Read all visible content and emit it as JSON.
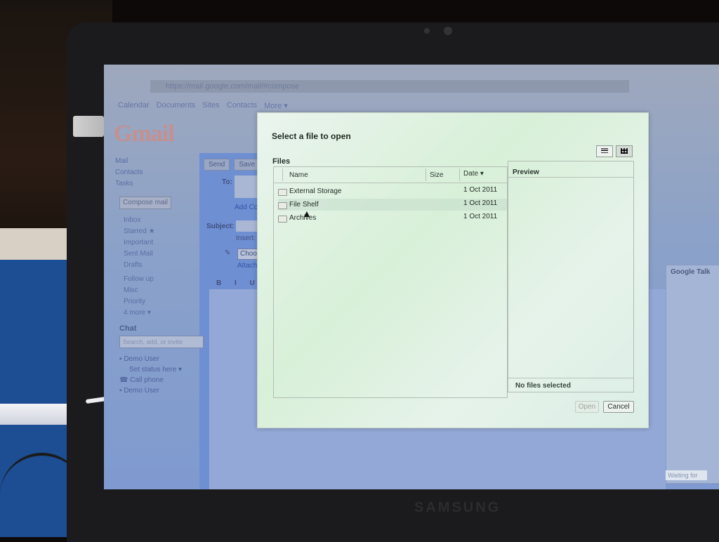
{
  "browser": {
    "url": "https://mail.google.com/mail/#compose"
  },
  "gmail": {
    "logo": "Gmail",
    "topnav": [
      "Calendar",
      "Documents",
      "Sites",
      "Contacts",
      "More ▾"
    ],
    "left_nav": [
      "Mail",
      "Contacts",
      "Tasks"
    ],
    "compose_button": "Compose mail",
    "labels": [
      "Inbox",
      "Starred ★",
      "Important",
      "Sent Mail",
      "Drafts",
      "Follow up",
      "Misc",
      "Priority",
      "4 more ▾"
    ],
    "chat": {
      "title": "Chat",
      "search_placeholder": "Search, add, or invite",
      "items": [
        "Demo User",
        "Set status here ▾",
        "Call phone",
        "Demo User"
      ]
    },
    "compose": {
      "send_label": "Send",
      "save_label": "Save",
      "to_label": "To:",
      "add_cc_label": "Add Cc",
      "subject_label": "Subject:",
      "insert_label": "Insert:",
      "choose_label": "Choose",
      "attach_label": "Attach a",
      "format_buttons": "B I U"
    },
    "talk": {
      "title": "Google Talk",
      "waiting": "Waiting for"
    }
  },
  "dialog": {
    "title": "Select a file to open",
    "section_label": "Files",
    "columns": {
      "name": "Name",
      "size": "Size",
      "date": "Date ▾"
    },
    "files": [
      {
        "name": "External Storage",
        "date": "1 Oct 2011",
        "icon": "folder-icon"
      },
      {
        "name": "File Shelf",
        "date": "1 Oct 2011",
        "icon": "folder-icon"
      },
      {
        "name": "Archives",
        "date": "1 Oct 2011",
        "icon": "folder-icon"
      }
    ],
    "preview_label": "Preview",
    "status": "No files selected",
    "open_label": "Open",
    "cancel_label": "Cancel"
  },
  "device": {
    "brand": "SAMSUNG"
  }
}
